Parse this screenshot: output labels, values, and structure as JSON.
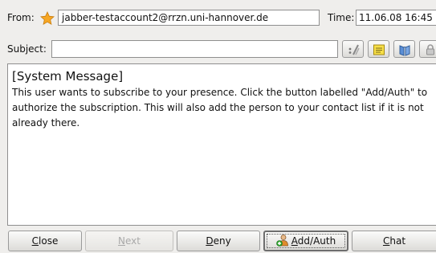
{
  "header": {
    "from_label": "From:",
    "from_value": "jabber-testaccount2@rrzn.uni-hannover.de",
    "time_label": "Time:",
    "time_value": "11.06.08 16:45",
    "subject_label": "Subject:",
    "subject_value": ""
  },
  "toolbar_icons": [
    "quote-reply-icon",
    "note-icon",
    "book-icon",
    "lock-icon"
  ],
  "message": {
    "title": "[System Message]",
    "body": "This user wants to subscribe to your presence. Click the button labelled \"Add/Auth\" to authorize the subscription. This will also add the person to your contact list if it is not already there."
  },
  "buttons": {
    "close": {
      "first": "C",
      "rest": "lose"
    },
    "next": {
      "first": "N",
      "rest": "ext"
    },
    "deny": {
      "first": "D",
      "rest": "eny"
    },
    "add_auth": {
      "first": "A",
      "rest": "dd/Auth"
    },
    "chat": {
      "first": "C",
      "rest": "hat"
    }
  },
  "colors": {
    "window_bg": "#efeeec",
    "star": "#f6a623"
  }
}
